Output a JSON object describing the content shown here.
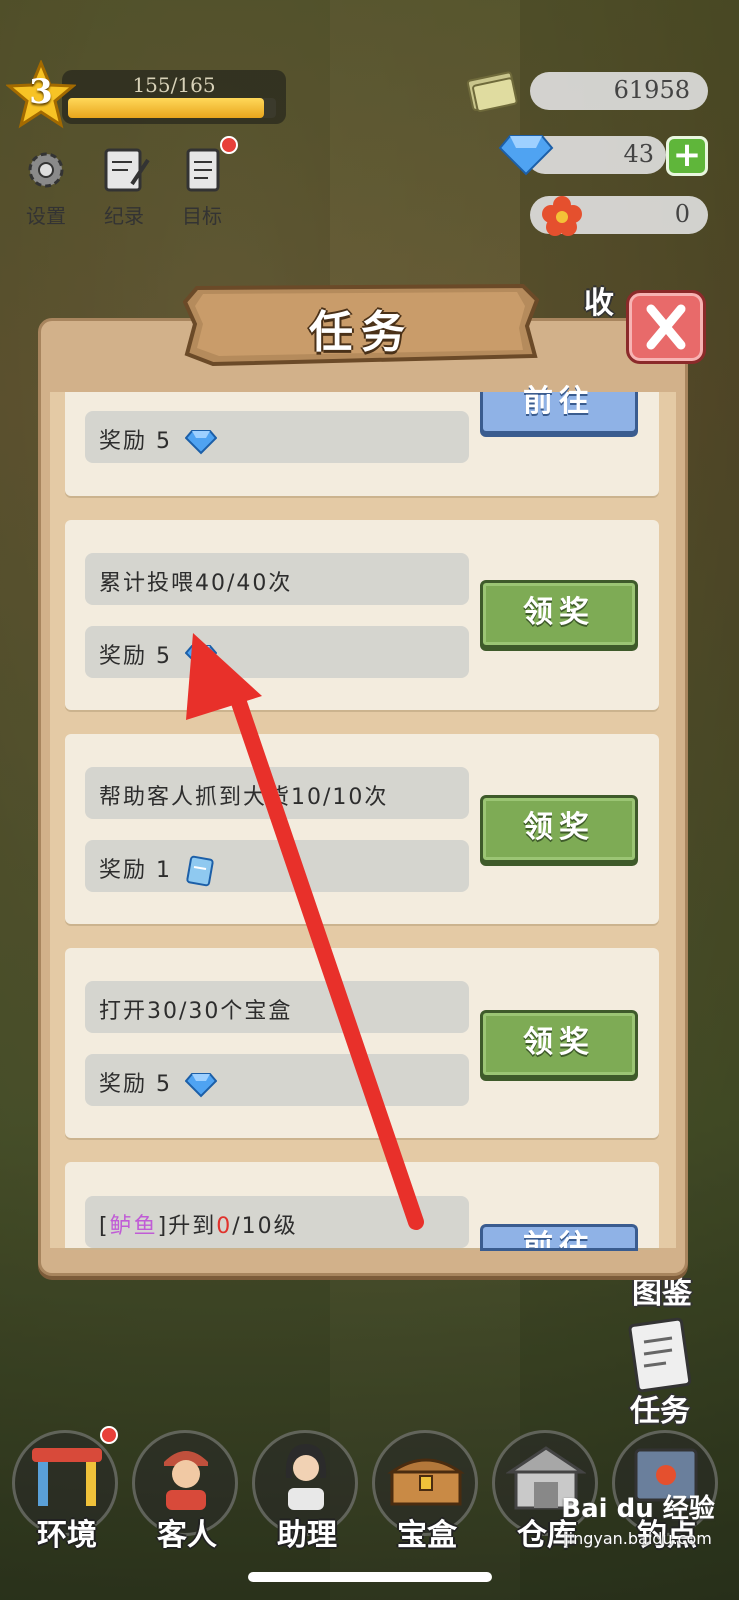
{
  "level": {
    "number": "3",
    "xp_text": "155/165",
    "xp_progress": 0.94
  },
  "currencies": {
    "cash": "61958",
    "gems": "43",
    "flowers": "0"
  },
  "top_icons": {
    "settings": "设置",
    "records": "纪录",
    "goals": "目标"
  },
  "panel": {
    "title": "任务",
    "tasks": [
      {
        "description": "",
        "reward_label": "奖励",
        "reward_amount": "5",
        "reward_icon": "diamond-icon",
        "button": "前往",
        "button_type": "go"
      },
      {
        "description": "累计投喂40/40次",
        "reward_label": "奖励",
        "reward_amount": "5",
        "reward_icon": "diamond-icon",
        "button": "领奖",
        "button_type": "claim"
      },
      {
        "description": "帮助客人抓到大货10/10次",
        "reward_label": "奖励",
        "reward_amount": "1",
        "reward_icon": "card-icon",
        "button": "领奖",
        "button_type": "claim"
      },
      {
        "description": "打开30/30个宝盒",
        "reward_label": "奖励",
        "reward_amount": "5",
        "reward_icon": "diamond-icon",
        "button": "领奖",
        "button_type": "claim"
      },
      {
        "description_prefix": "[",
        "fish_name": "鲈鱼",
        "description_mid": "]升到",
        "current_level": "0",
        "description_suffix": "/10级",
        "button": "前往",
        "button_type": "go"
      }
    ]
  },
  "side": {
    "partial_top": "收",
    "album": "图鉴",
    "tasks": "任务"
  },
  "bottom_nav": [
    "环境",
    "客人",
    "助理",
    "宝盒",
    "仓库",
    "钓点"
  ],
  "watermark": {
    "brand": "Bai du 经验",
    "url": "jingyan.baidu.com"
  },
  "colors": {
    "claim": "#7eab55",
    "go": "#8fb2e6",
    "arrow": "#e8302a",
    "fish_name": "#c05bd6"
  }
}
